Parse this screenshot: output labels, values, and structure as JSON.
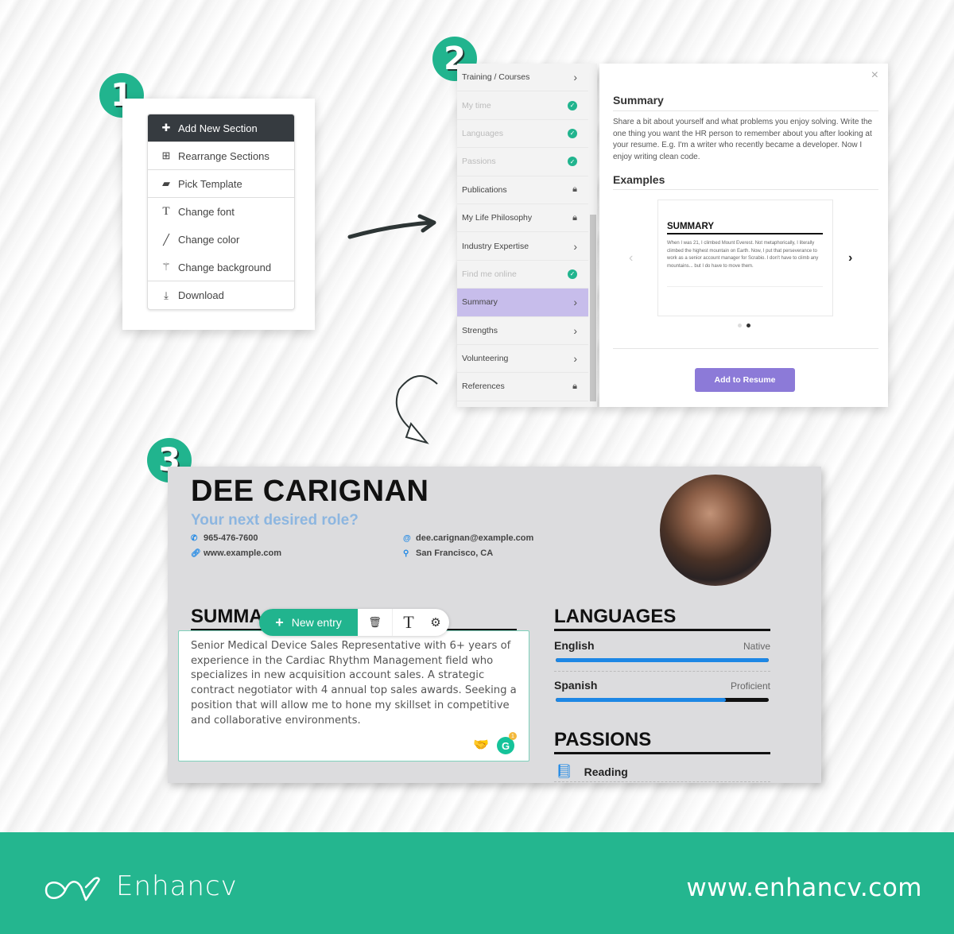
{
  "steps": [
    "1",
    "2",
    "3"
  ],
  "menu": {
    "items": [
      {
        "label": "Add New Section",
        "icon": "add-section-icon",
        "glyph": "✚",
        "active": true
      },
      {
        "label": "Rearrange Sections",
        "icon": "layout-icon",
        "glyph": "⊞"
      },
      {
        "label": "Pick Template",
        "icon": "template-icon",
        "glyph": "▰"
      },
      {
        "label": "Change font",
        "icon": "font-icon",
        "glyph": "T"
      },
      {
        "label": "Change color",
        "icon": "brush-icon",
        "glyph": "╱"
      },
      {
        "label": "Change background",
        "icon": "magic-wand-icon",
        "glyph": "⚚"
      },
      {
        "label": "Download",
        "icon": "download-icon",
        "glyph": "⤓"
      }
    ]
  },
  "sections_sidebar": {
    "items": [
      {
        "label": "Training / Courses",
        "state": "arrow"
      },
      {
        "label": "My time",
        "state": "added"
      },
      {
        "label": "Languages",
        "state": "added"
      },
      {
        "label": "Passions",
        "state": "added"
      },
      {
        "label": "Publications",
        "state": "locked"
      },
      {
        "label": "My Life Philosophy",
        "state": "locked"
      },
      {
        "label": "Industry Expertise",
        "state": "arrow"
      },
      {
        "label": "Find me online",
        "state": "added"
      },
      {
        "label": "Summary",
        "state": "arrow",
        "selected": true
      },
      {
        "label": "Strengths",
        "state": "arrow"
      },
      {
        "label": "Volunteering",
        "state": "arrow"
      },
      {
        "label": "References",
        "state": "locked"
      }
    ]
  },
  "section_modal": {
    "title": "Summary",
    "description": "Share a bit about yourself and what problems you enjoy solving. Write the one thing you want the HR person to remember about you after looking at your resume. E.g. I'm a writer who recently became a developer. Now I enjoy writing clean code.",
    "examples_heading": "Examples",
    "example": {
      "title": "SUMMARY",
      "text": "When I was 21, I climbed Mount Everest. Not metaphorically, I literally climbed the highest mountain on Earth. Now, I put that perseverance to work as a senior account manager for Scrabio. I don't have to climb any mountains... but I do have to move them."
    },
    "carousel": {
      "count": 2,
      "current": 2
    },
    "add_button": "Add to Resume",
    "close": "×"
  },
  "resume": {
    "name": "DEE CARIGNAN",
    "role_placeholder": "Your next desired role?",
    "phone": "965-476-7600",
    "website": "www.example.com",
    "email": "dee.carignan@example.com",
    "location": "San Francisco, CA",
    "summary_heading": "SUMMA",
    "summary_text": "Senior Medical Device Sales Representative with 6+ years of experience in the Cardiac Rhythm Management field who specializes in new acquisition account sales. A strategic contract negotiator with 4 annual top sales awards. Seeking a position that will allow me to hone my skillset in competitive and collaborative environments.",
    "toolbar": {
      "new_entry": "New entry",
      "grammarly_count": "1"
    },
    "languages_heading": "LANGUAGES",
    "languages": [
      {
        "name": "English",
        "level": "Native",
        "proficiency": 1.0
      },
      {
        "name": "Spanish",
        "level": "Proficient",
        "proficiency": 0.8
      }
    ],
    "passions_heading": "PASSIONS",
    "passions": [
      {
        "label": "Reading"
      }
    ]
  },
  "footer": {
    "brand": "Enhancv",
    "url": "www.enhancv.com"
  },
  "colors": {
    "brand": "#24b68f",
    "accent_purple": "#8c7ad8",
    "selected": "#c7bdeb",
    "bar": "#1d87e5"
  }
}
